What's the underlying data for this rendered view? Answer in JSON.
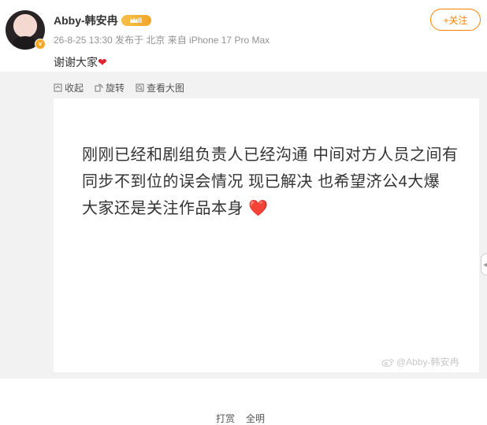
{
  "user": {
    "name": "Abby-韩安冉",
    "vip_badge": "II",
    "verified_badge": "v",
    "meta": "26-8-25 13:30 发布于 北京 来自 iPhone 17 Pro Max"
  },
  "follow_button": {
    "icon": "plus-icon",
    "label": "+关注"
  },
  "post": {
    "text": "谢谢大家",
    "emoji": "❤"
  },
  "toolbar": {
    "collect": "收起",
    "rotate": "旋转",
    "view_large": "查看大图"
  },
  "image": {
    "text": "刚刚已经和剧组负责人已经沟通 中间对方人员之间有同步不到位的误会情况 现已解决 也希望济公4大爆 大家还是关注作品本身",
    "emoji": "❤️",
    "watermark": "@Abby-韩安冉"
  },
  "bottom": {
    "left": "打赏",
    "right": "全明"
  },
  "colors": {
    "accent": "#ff8200",
    "heart": "#e0242e",
    "panel_bg": "#f2f2f2"
  }
}
